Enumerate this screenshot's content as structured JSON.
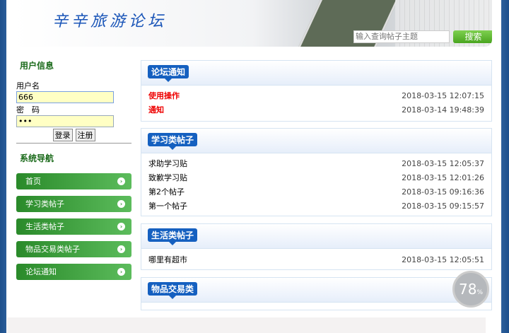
{
  "header": {
    "logo": "辛辛旅游论坛",
    "search_placeholder": "输入查询帖子主题",
    "search_button": "搜索"
  },
  "sidebar": {
    "user_title": "用户信息",
    "username_label": "用户名",
    "username_value": "666",
    "password_label": "密　码",
    "password_value": "•••",
    "login": "登录",
    "register": "注册",
    "nav_title": "系统导航",
    "nav": [
      {
        "label": "首页"
      },
      {
        "label": "学习类帖子"
      },
      {
        "label": "生活类帖子"
      },
      {
        "label": "物品交易类帖子"
      },
      {
        "label": "论坛通知"
      }
    ]
  },
  "sections": [
    {
      "title": "论坛通知",
      "posts": [
        {
          "title": "使用操作",
          "date": "2018-03-15 12:07:15"
        },
        {
          "title": "通知",
          "date": "2018-03-14 19:48:39"
        }
      ]
    },
    {
      "title": "学习类帖子",
      "posts": [
        {
          "title": "求助学习贴",
          "date": "2018-03-15 12:05:37"
        },
        {
          "title": "致歉学习贴",
          "date": "2018-03-15 12:01:26"
        },
        {
          "title": "第2个帖子",
          "date": "2018-03-15 09:16:36"
        },
        {
          "title": "第一个帖子",
          "date": "2018-03-15 09:15:57"
        }
      ]
    },
    {
      "title": "生活类帖子",
      "posts": [
        {
          "title": "哪里有超市",
          "date": "2018-03-15 12:05:51"
        }
      ]
    },
    {
      "title": "物品交易类",
      "posts": []
    }
  ],
  "widget": {
    "percent": "78",
    "unit": "%"
  }
}
